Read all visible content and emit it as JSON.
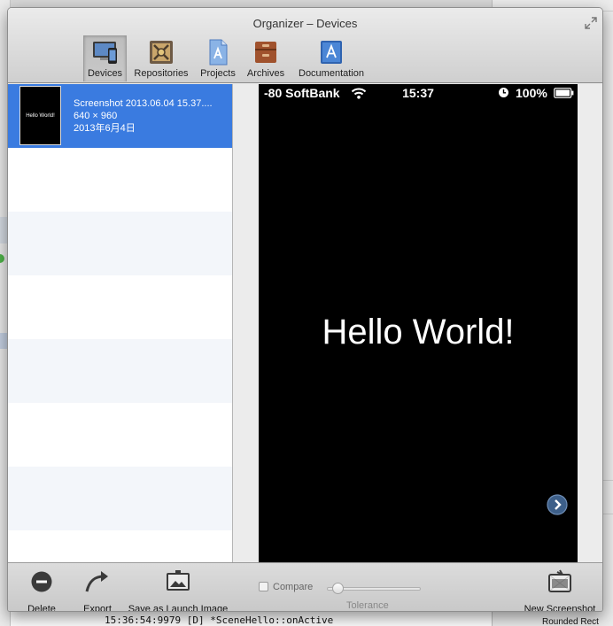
{
  "window": {
    "title": "Organizer – Devices"
  },
  "toolbar": {
    "items": [
      {
        "label": "Devices",
        "icon": "devices-icon",
        "selected": true
      },
      {
        "label": "Repositories",
        "icon": "repositories-icon"
      },
      {
        "label": "Projects",
        "icon": "projects-icon"
      },
      {
        "label": "Archives",
        "icon": "archives-icon"
      },
      {
        "label": "Documentation",
        "icon": "documentation-icon"
      }
    ]
  },
  "list": {
    "items": [
      {
        "title": "Screenshot 2013.06.04 15.37....",
        "resolution": "640 × 960",
        "date": "2013年6月4日",
        "thumb_text": "Hello World!",
        "selected": true
      }
    ]
  },
  "preview": {
    "status_bar": {
      "carrier": "-80 SoftBank",
      "time": "15:37",
      "battery": "100%"
    },
    "content_text": "Hello World!"
  },
  "bottom_bar": {
    "delete_label": "Delete",
    "export_label": "Export",
    "launch_label": "Save as Launch Image",
    "compare_label": "Compare",
    "tolerance_label": "Tolerance",
    "tolerance_value": 0.1,
    "new_screenshot_label": "New Screenshot"
  },
  "background": {
    "console_line": "15:36:54:9979 [D] *SceneHello::onActive",
    "rounded_label": "Rounded Rect"
  },
  "colors": {
    "selection": "#3a7be0",
    "phone_screen": "#000000"
  }
}
